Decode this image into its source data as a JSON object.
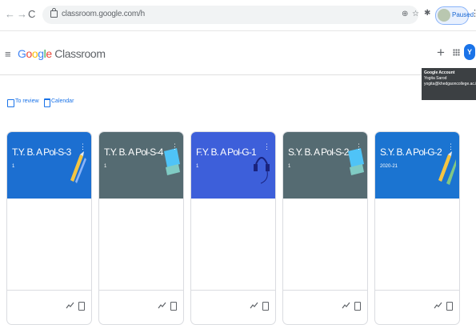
{
  "browser": {
    "url": "classroom.google.com/h",
    "profile_label": "Paused",
    "icons": [
      "back-icon",
      "forward-icon",
      "reload-icon",
      "lock-icon",
      "zoom-icon",
      "star-icon",
      "extensions-icon",
      "more-icon"
    ]
  },
  "header": {
    "logo_google": [
      "G",
      "o",
      "o",
      "g",
      "l",
      "e"
    ],
    "logo_classroom": "Classroom",
    "avatar_initial": "Y",
    "icons": [
      "menu-icon",
      "add-icon",
      "apps-icon"
    ]
  },
  "tooltip": {
    "title": "Google Account",
    "name": "Yogita Sarod",
    "email": "yogita@khedgaoncollege.ac.in"
  },
  "links": {
    "to_review": "To review",
    "calendar": "Calendar"
  },
  "colors": {
    "accent": "#1a73e8",
    "card_blue": "#1e6ac6",
    "card_gray": "#546b73",
    "card_royal": "#3b5bdb",
    "card_teal": "#1b74d1"
  },
  "cards": [
    {
      "title": "T.Y. B. A Pol-S-3",
      "subtitle": "1",
      "color": "#1c6fd1"
    },
    {
      "title": "T.Y. B. A Pol-S-4",
      "subtitle": "1",
      "color": "#556b72"
    },
    {
      "title": "F.Y. B. A Pol-G-1",
      "subtitle": "1",
      "color": "#3d5fda"
    },
    {
      "title": "S.Y. B. A Pol-S-2",
      "subtitle": "1",
      "color": "#556b72"
    },
    {
      "title": "S.Y. B. A Pol-G-2",
      "subtitle": "2020-21",
      "color": "#1b74d1"
    }
  ]
}
